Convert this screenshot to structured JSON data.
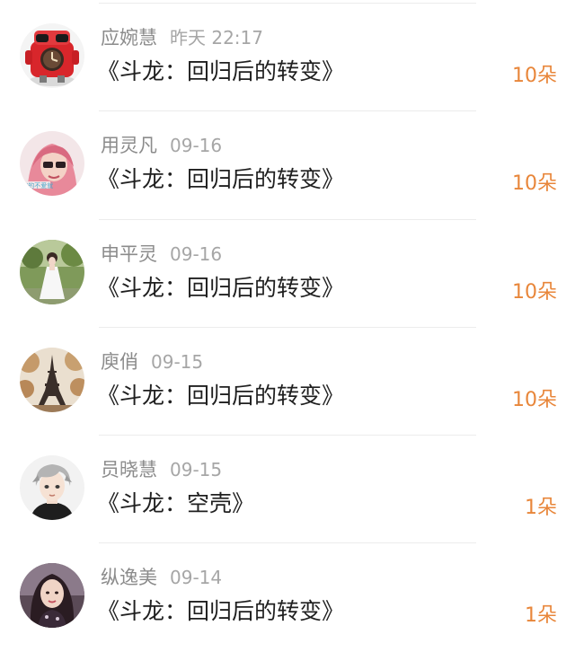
{
  "entries": [
    {
      "name": "应婉慧",
      "time": "昨天 22:17",
      "title": "《斗龙：回归后的转变》",
      "gift": "10朵",
      "avatar_icon": "red-toy-robot-avatar"
    },
    {
      "name": "用灵凡",
      "time": "09-16",
      "title": "《斗龙：回归后的转变》",
      "gift": "10朵",
      "avatar_icon": "pink-hair-girl-avatar"
    },
    {
      "name": "申平灵",
      "time": "09-16",
      "title": "《斗龙：回归后的转变》",
      "gift": "10朵",
      "avatar_icon": "girl-white-dress-avatar"
    },
    {
      "name": "庾俏",
      "time": "09-15",
      "title": "《斗龙：回归后的转变》",
      "gift": "10朵",
      "avatar_icon": "eiffel-tower-avatar"
    },
    {
      "name": "员晓慧",
      "time": "09-15",
      "title": "《斗龙：空壳》",
      "gift": "1朵",
      "avatar_icon": "anime-boy-avatar"
    },
    {
      "name": "纵逸美",
      "time": "09-14",
      "title": "《斗龙：回归后的转变》",
      "gift": "1朵",
      "avatar_icon": "woman-portrait-avatar"
    }
  ],
  "colors": {
    "name": "#8b8b8b",
    "time": "#a6a6a6",
    "title": "#1f1f1f",
    "gift_accent": "#e8863a",
    "divider": "#ececec"
  }
}
